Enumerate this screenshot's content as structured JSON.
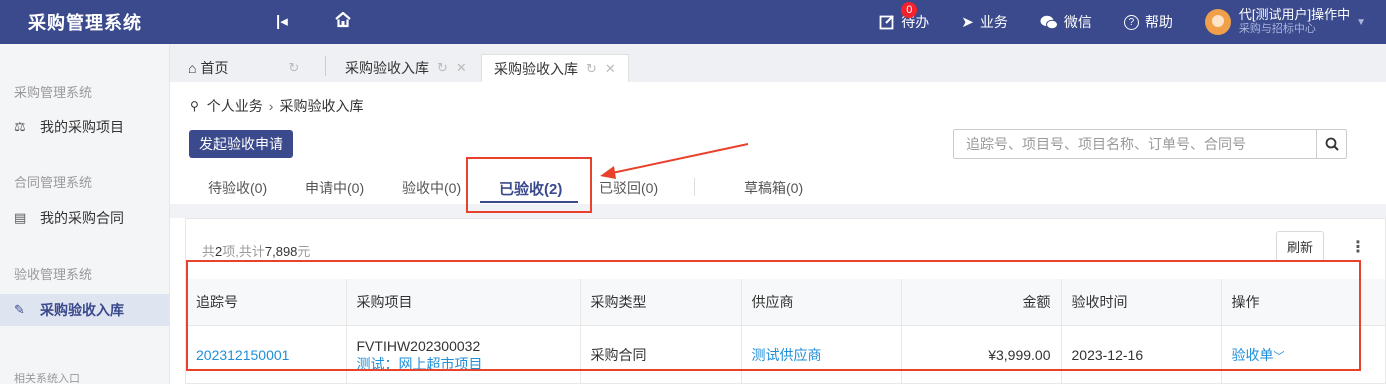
{
  "app": {
    "title": "采购管理系统"
  },
  "header": {
    "items": [
      {
        "icon": "edit-icon",
        "label": "待办",
        "badge": "0"
      },
      {
        "icon": "send-icon",
        "label": "业务"
      },
      {
        "icon": "wechat-icon",
        "label": "微信"
      },
      {
        "icon": "help-icon",
        "label": "帮助"
      }
    ],
    "user": {
      "name": "代[测试用户]操作中",
      "org": "采购与招标中心"
    }
  },
  "sidebar": {
    "groups": [
      {
        "title": "采购管理系统",
        "items": [
          {
            "icon": "scale-icon",
            "label": "我的采购项目"
          }
        ]
      },
      {
        "title": "合同管理系统",
        "items": [
          {
            "icon": "contract-icon",
            "label": "我的采购合同"
          }
        ]
      },
      {
        "title": "验收管理系统",
        "items": [
          {
            "icon": "pen-icon",
            "label": "采购验收入库",
            "active": true
          }
        ]
      }
    ],
    "footer": "相关系统入口"
  },
  "page_tabs": [
    {
      "label": "首页",
      "icon": "home-icon"
    },
    {
      "label": "采购验收入库"
    },
    {
      "label": "采购验收入库",
      "active": true
    }
  ],
  "breadcrumb": {
    "root": "个人业务",
    "current": "采购验收入库"
  },
  "actions": {
    "apply_label": "发起验收申请"
  },
  "search": {
    "placeholder": "追踪号、项目号、项目名称、订单号、合同号"
  },
  "status_tabs": [
    {
      "label": "待验收(0)"
    },
    {
      "label": "申请中(0)"
    },
    {
      "label": "验收中(0)"
    },
    {
      "label": "已验收(2)",
      "active": true
    },
    {
      "label": "已驳回(0)"
    },
    {
      "label": "草稿箱(0)"
    }
  ],
  "summary": {
    "prefix": "共",
    "count": "2",
    "mid": "项,共计",
    "total": "7,898",
    "suffix": "元"
  },
  "refresh_label": "刷新",
  "table": {
    "columns": [
      "追踪号",
      "采购项目",
      "采购类型",
      "供应商",
      "金额",
      "验收时间",
      "操作"
    ],
    "rows": [
      {
        "tracking_no": "202312150001",
        "project_code": "FVTIHW202300032",
        "project_name": "测试：网上超市项目",
        "type": "采购合同",
        "supplier": "测试供应商",
        "amount": "¥3,999.00",
        "date": "2023-12-16",
        "action": "验收单"
      }
    ]
  },
  "colors": {
    "primary": "#3a4a8c",
    "link": "#1f8fd8",
    "annotation": "#e8412c"
  }
}
